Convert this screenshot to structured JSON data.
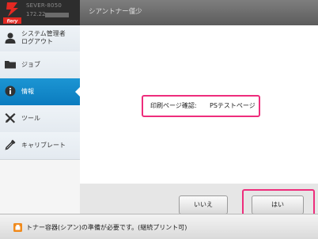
{
  "header": {
    "device_name": "SEVER-8050",
    "device_ip": "172.22.",
    "toner_title": "シアントナー僅少"
  },
  "sidebar": {
    "items": [
      {
        "label": "システム管理者\nログアウト",
        "icon": "user-icon",
        "active": false
      },
      {
        "label": "ジョブ",
        "icon": "folder-icon",
        "active": false
      },
      {
        "label": "情報",
        "icon": "info-icon",
        "active": true
      },
      {
        "label": "ツール",
        "icon": "tools-icon",
        "active": false
      },
      {
        "label": "キャリブレート",
        "icon": "dropper-icon",
        "active": false
      }
    ]
  },
  "main": {
    "message_label": "印刷ページ確認:",
    "message_value": "PSテストページ",
    "no_label": "いいえ",
    "yes_label": "はい"
  },
  "status": {
    "text": "トナー容器(シアン)の準備が必要です。(継続プリント可)"
  },
  "colors": {
    "accent": "#1a8fcf",
    "highlight": "#ee2d7c",
    "warning": "#f08a1c"
  }
}
